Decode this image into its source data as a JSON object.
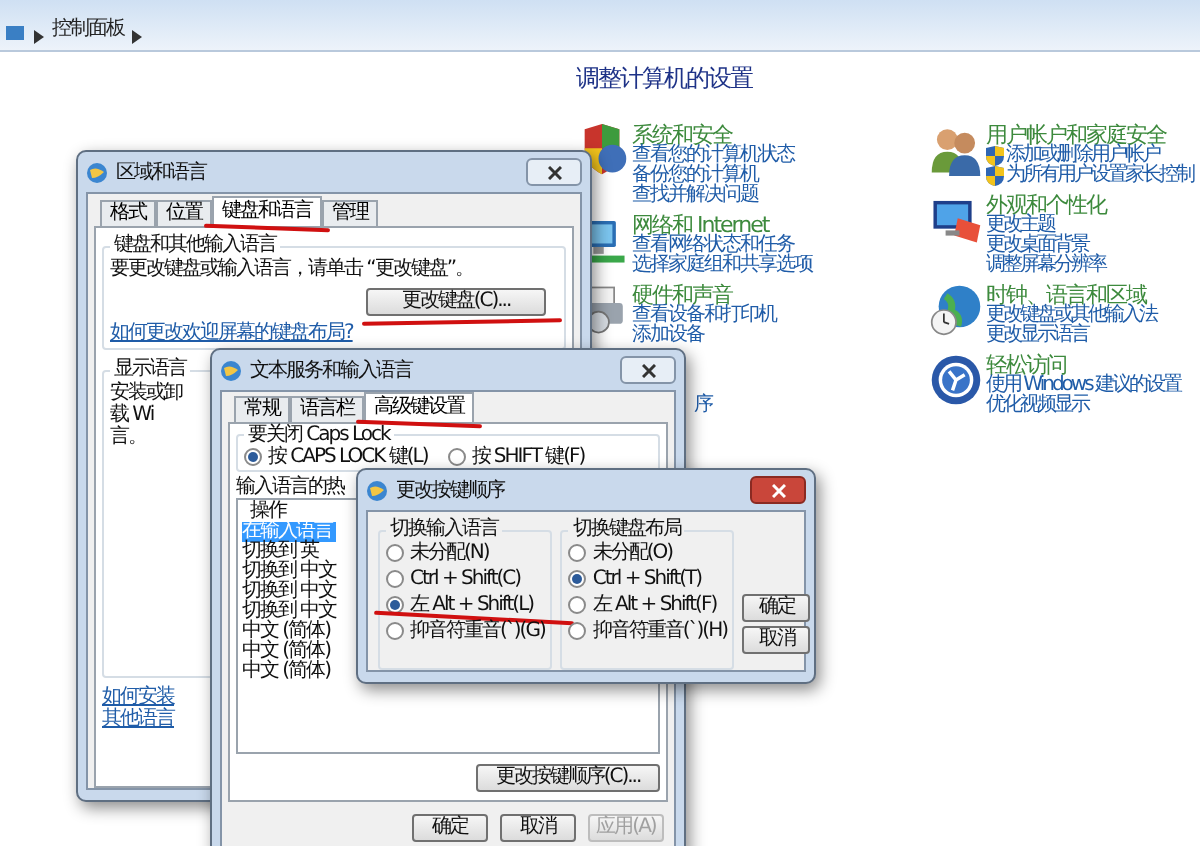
{
  "breadcrumb": [
    "控制面板"
  ],
  "control_panel": {
    "title": "调整计算机的设置",
    "columns": [
      [
        {
          "kind": "security",
          "title": "系统和安全",
          "links": [
            {
              "text": "查看您的计算机状态",
              "shield": false
            },
            {
              "text": "备份您的计算机",
              "shield": false
            },
            {
              "text": "查找并解决问题",
              "shield": false
            }
          ]
        },
        {
          "kind": "network",
          "title": "网络和 Internet",
          "links": [
            {
              "text": "查看网络状态和任务",
              "shield": false
            },
            {
              "text": "选择家庭组和共享选项",
              "shield": false
            }
          ]
        },
        {
          "kind": "hardware",
          "title": "硬件和声音",
          "links": [
            {
              "text": "查看设备和打印机",
              "shield": false
            },
            {
              "text": "添加设备",
              "shield": false
            }
          ]
        }
      ],
      [
        {
          "kind": "users",
          "title": "用户帐户和家庭安全",
          "links": [
            {
              "text": "添加或删除用户帐户",
              "shield": true
            },
            {
              "text": "为所有用户设置家长控制",
              "shield": true
            }
          ]
        },
        {
          "kind": "appearance",
          "title": "外观和个性化",
          "links": [
            {
              "text": "更改主题",
              "shield": false
            },
            {
              "text": "更改桌面背景",
              "shield": false
            },
            {
              "text": "调整屏幕分辨率",
              "shield": false
            }
          ]
        },
        {
          "kind": "clock",
          "title": "时钟、语言和区域",
          "links": [
            {
              "text": "更改键盘或其他输入法",
              "shield": false
            },
            {
              "text": "更改显示语言",
              "shield": false
            }
          ]
        },
        {
          "kind": "access",
          "title": "轻松访问",
          "links": [
            {
              "text": "使用 Windows 建议的设置",
              "shield": false
            },
            {
              "text": "优化视频显示",
              "shield": false
            }
          ]
        }
      ]
    ],
    "hidden_link_fragment": "序"
  },
  "region_dialog": {
    "title": "区域和语言",
    "tabs": [
      {
        "label": "格式",
        "selected": false,
        "annotated": false
      },
      {
        "label": "位置",
        "selected": false,
        "annotated": false
      },
      {
        "label": "键盘和语言",
        "selected": true,
        "annotated": true
      },
      {
        "label": "管理",
        "selected": false,
        "annotated": false
      }
    ],
    "keyboard_group": {
      "legend": "键盘和其他输入语言",
      "text": "要更改键盘或输入语言，请单击 “更改键盘”。",
      "button": {
        "label": "更改键盘(C)...",
        "annotated": true
      },
      "link": "如何更改欢迎屏幕的键盘布局?"
    },
    "display_group": {
      "legend": "显示语言",
      "lines": [
        "安装或卸载 Wi",
        "言。"
      ]
    },
    "link": "如何安装其他语言"
  },
  "text_services_dialog": {
    "title": "文本服务和输入语言",
    "tabs": [
      {
        "label": "常规",
        "selected": false,
        "annotated": false
      },
      {
        "label": "语言栏",
        "selected": false,
        "annotated": false
      },
      {
        "label": "高级键设置",
        "selected": true,
        "annotated": true
      }
    ],
    "caps_group": {
      "legend": "要关闭 Caps Lock",
      "options": [
        {
          "label": "按 CAPS LOCK 键(L)",
          "selected": true
        },
        {
          "label": "按 SHIFT 键(F)",
          "selected": false
        }
      ]
    },
    "hotkeys_label": "输入语言的热",
    "list": {
      "header": "操作",
      "rows": [
        {
          "text": "在输入语言",
          "selected": true
        },
        {
          "text": "切换到 英",
          "selected": false
        },
        {
          "text": "切换到 中文",
          "selected": false
        },
        {
          "text": "切换到 中文",
          "selected": false
        },
        {
          "text": "切换到 中文",
          "selected": false
        },
        {
          "text": "中文 (简体)",
          "selected": false
        },
        {
          "text": "中文 (简体)",
          "selected": false
        },
        {
          "text": "中文 (简体)",
          "selected": false
        }
      ]
    },
    "change_button": "更改按键顺序(C)...",
    "buttons": [
      {
        "label": "确定",
        "disabled": false
      },
      {
        "label": "取消",
        "disabled": false
      },
      {
        "label": "应用(A)",
        "disabled": true
      }
    ]
  },
  "key_sequence_dialog": {
    "title": "更改按键顺序",
    "groups": [
      {
        "legend": "切换输入语言",
        "options": [
          {
            "label": "未分配(N)",
            "selected": false,
            "annotated": false
          },
          {
            "label": "Ctrl + Shift(C)",
            "selected": false,
            "annotated": false
          },
          {
            "label": "左 Alt + Shift(L)",
            "selected": true,
            "annotated": true
          },
          {
            "label": "抑音符重音(`)(G)",
            "selected": false,
            "annotated": false
          }
        ]
      },
      {
        "legend": "切换键盘布局",
        "options": [
          {
            "label": "未分配(O)",
            "selected": false,
            "annotated": false
          },
          {
            "label": "Ctrl + Shift(T)",
            "selected": true,
            "annotated": false
          },
          {
            "label": "左 Alt + Shift(F)",
            "selected": false,
            "annotated": false
          },
          {
            "label": "抑音符重音(`)(H)",
            "selected": false,
            "annotated": false
          }
        ]
      }
    ],
    "buttons": [
      "确定",
      "取消"
    ]
  }
}
